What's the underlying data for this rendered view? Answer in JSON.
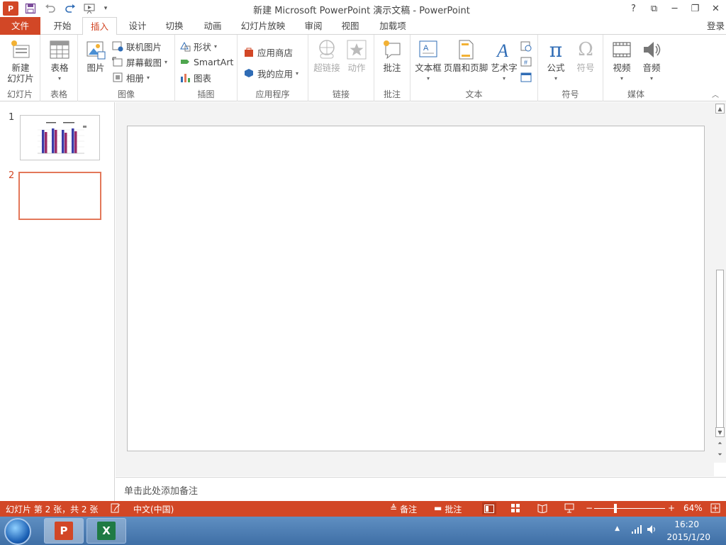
{
  "window": {
    "title": "新建 Microsoft PowerPoint 演示文稿 - PowerPoint",
    "help": "?",
    "restore_ribbon": "⧉",
    "minimize": "─",
    "maximize": "❐",
    "close": "✕"
  },
  "qat": {
    "app_icon": "P",
    "save_icon": "save-icon",
    "undo_icon": "undo-icon",
    "redo_icon": "redo-icon",
    "present_icon": "present-icon"
  },
  "tabs": [
    "文件",
    "开始",
    "插入",
    "设计",
    "切换",
    "动画",
    "幻灯片放映",
    "审阅",
    "视图",
    "加载项"
  ],
  "active_tab": "插入",
  "login": "登录",
  "ribbon": {
    "slides": {
      "group": "幻灯片",
      "new_slide": "新建",
      "new_slide2": "幻灯片"
    },
    "tables": {
      "group": "表格",
      "table": "表格"
    },
    "images": {
      "group": "图像",
      "picture": "图片",
      "online_picture": "联机图片",
      "screenshot": "屏幕截图",
      "album": "相册"
    },
    "illustrations": {
      "group": "插图",
      "shapes": "形状",
      "smartart": "SmartArt",
      "chart": "图表"
    },
    "apps": {
      "group": "应用程序",
      "store": "应用商店",
      "my_apps": "我的应用"
    },
    "links": {
      "group": "链接",
      "hyperlink": "超链接",
      "action": "动作"
    },
    "comments": {
      "group": "批注",
      "comment": "批注"
    },
    "text": {
      "group": "文本",
      "textbox": "文本框",
      "header_footer": "页眉和页脚",
      "wordart": "艺术字"
    },
    "symbols": {
      "group": "符号",
      "equation": "公式",
      "symbol": "符号"
    },
    "media": {
      "group": "媒体",
      "video": "视频",
      "audio": "音频"
    }
  },
  "thumbnails": [
    {
      "num": "1"
    },
    {
      "num": "2"
    }
  ],
  "notes_placeholder": "单击此处添加备注",
  "status": {
    "slide_info": "幻灯片 第 2 张，共 2 张",
    "language": "中文(中国)",
    "notes": "备注",
    "comments": "批注",
    "zoom": "64%",
    "zoom_minus": "−",
    "zoom_plus": "+"
  },
  "taskbar": {
    "time": "16:20",
    "date": "2015/1/20",
    "ppt_icon": "P",
    "excel_icon": "X"
  },
  "colors": {
    "accent": "#d24726",
    "selected_thumb": "#e3785a"
  }
}
